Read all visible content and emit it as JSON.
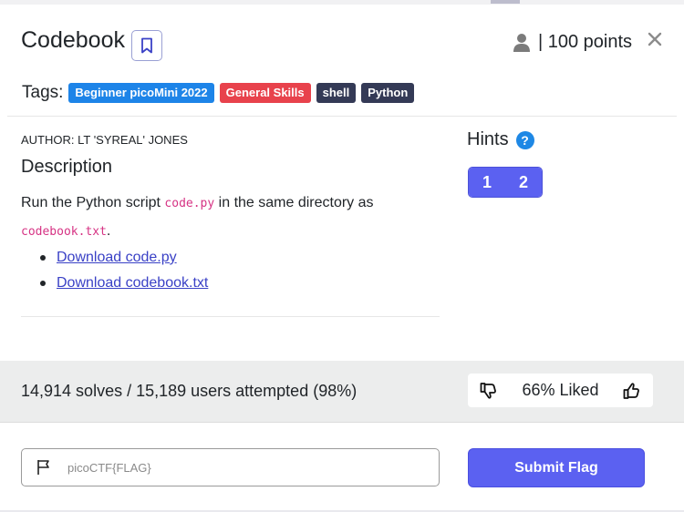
{
  "challenge": {
    "title": "Codebook",
    "points_label": "| 100 points",
    "tags_label": "Tags:",
    "tags": [
      {
        "label": "Beginner picoMini 2022",
        "color": "#1d84e8"
      },
      {
        "label": "General Skills",
        "color": "#e8424c"
      },
      {
        "label": "shell",
        "color": "#343a56"
      },
      {
        "label": "Python",
        "color": "#343a56"
      }
    ],
    "author": "AUTHOR: LT 'SYREAL' JONES",
    "description_heading": "Description",
    "description": {
      "text_before": "Run the Python script ",
      "code1": "code.py",
      "text_middle": " in the same directory as",
      "code2": "codebook.txt",
      "text_after": "."
    },
    "downloads": [
      "Download code.py",
      "Download codebook.txt"
    ]
  },
  "hints": {
    "heading": "Hints",
    "help_glyph": "?",
    "buttons": [
      "1",
      "2"
    ]
  },
  "stats": {
    "solves": "14,914 solves / 15,189 users attempted (98%)",
    "liked": "66% Liked"
  },
  "flag_form": {
    "placeholder": "picoCTF{FLAG}",
    "submit_label": "Submit Flag"
  },
  "icons": {
    "bookmark": "bookmark-icon",
    "user": "user-icon",
    "close": "close-icon",
    "help": "help-icon",
    "thumbs_down": "thumbs-down-icon",
    "thumbs_up": "thumbs-up-icon",
    "flag": "flag-icon"
  },
  "colors": {
    "accent": "#5b61f1",
    "link": "#3a41c6",
    "code": "#d63384",
    "help": "#1e88e5"
  }
}
